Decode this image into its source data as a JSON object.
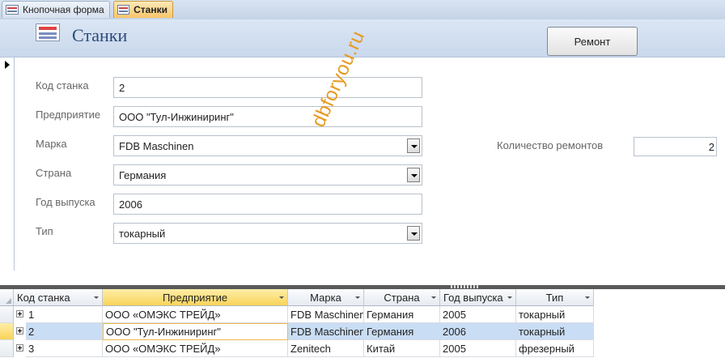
{
  "tabs": [
    {
      "label": "Кнопочная форма",
      "active": false
    },
    {
      "label": "Станки",
      "active": true
    }
  ],
  "header": {
    "title": "Станки",
    "repair_button": "Ремонт"
  },
  "form": {
    "code_label": "Код станка",
    "code_value": "2",
    "enterprise_label": "Предприятие",
    "enterprise_value": "ООО \"Тул-Инжиниринг\"",
    "brand_label": "Марка",
    "brand_value": "FDB Maschinen",
    "country_label": "Страна",
    "country_value": "Германия",
    "year_label": "Год выпуска",
    "year_value": "2006",
    "type_label": "Тип",
    "type_value": "токарный",
    "repairs_label": "Количество ремонтов",
    "repairs_value": "2"
  },
  "watermark": "dbforyou.ru",
  "datasheet": {
    "columns": [
      "Код станка",
      "Предприятие",
      "Марка",
      "Страна",
      "Год выпуска",
      "Тип"
    ],
    "rows": [
      {
        "code": "1",
        "enterprise": "ООО «ОМЭКС ТРЕЙД»",
        "brand": "FDB Maschinen",
        "country": "Германия",
        "year": "2005",
        "type": "токарный"
      },
      {
        "code": "2",
        "enterprise": "ООО \"Тул-Инжиниринг\"",
        "brand": "FDB Maschinen",
        "country": "Германия",
        "year": "2006",
        "type": "токарный"
      },
      {
        "code": "3",
        "enterprise": "ООО «ОМЭКС ТРЕЙД»",
        "brand": "Zenitech",
        "country": "Китай",
        "year": "2005",
        "type": "фрезерный"
      }
    ],
    "current_row": 1
  },
  "colors": {
    "header_band": "#c9d8ec",
    "title": "#2c4a7a",
    "active_tab": "#f8c56a",
    "selected_row": "#c9ddf4",
    "watermark": "#e89a22"
  }
}
